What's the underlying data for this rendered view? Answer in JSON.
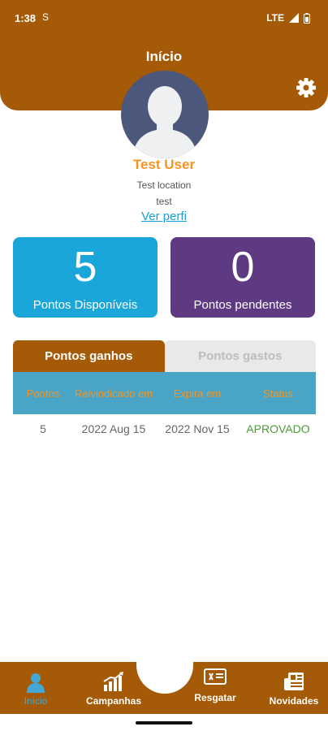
{
  "status_bar": {
    "time": "1:38",
    "app_indicator": "S",
    "network": "LTE"
  },
  "header": {
    "title": "Início"
  },
  "colors": {
    "brand": "#A45A06",
    "accent": "#F7941D",
    "blue_card": "#1BA6D9",
    "purple_card": "#5E3A83",
    "table_header": "#4AA4C6",
    "approved": "#4E9A3C",
    "link": "#1A9ED8"
  },
  "profile": {
    "name": "Test User",
    "location": "Test location",
    "subtitle": "test",
    "link": "Ver perfi"
  },
  "cards": [
    {
      "value": "5",
      "label": "Pontos Disponíveis"
    },
    {
      "value": "0",
      "label": "Pontos pendentes"
    }
  ],
  "tabs": [
    {
      "label": "Pontos ganhos",
      "active": true
    },
    {
      "label": "Pontos gastos",
      "active": false
    }
  ],
  "table": {
    "headers": [
      "Pontos",
      "Reivindicado em",
      "Expira em",
      "Status"
    ],
    "rows": [
      [
        "5",
        "2022 Aug 15",
        "2022 Nov 15",
        "APROVADO"
      ]
    ]
  },
  "nav": [
    {
      "label": "Início",
      "icon": "user-icon",
      "active": true
    },
    {
      "label": "Campanhas",
      "icon": "chart-icon",
      "active": false
    },
    {
      "label": "Resgatar",
      "icon": "voucher-icon",
      "active": false
    },
    {
      "label": "Novidades",
      "icon": "news-icon",
      "active": false
    }
  ]
}
